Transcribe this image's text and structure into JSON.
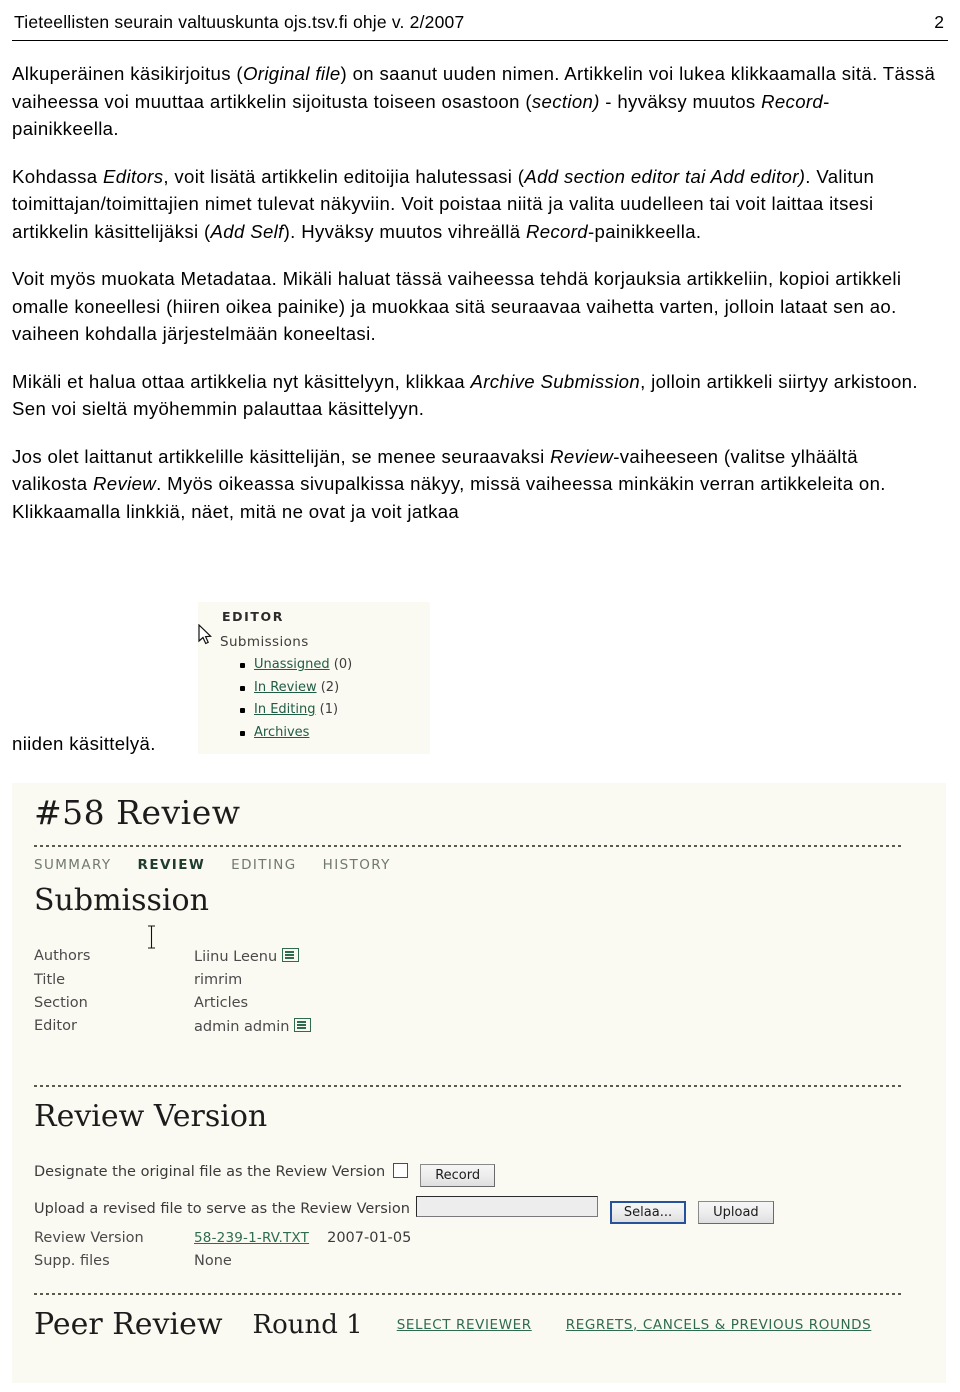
{
  "header": {
    "title": "Tieteellisten seurain valtuuskunta ojs.tsv.fi ohje v. 2/2007",
    "page_number": "2"
  },
  "body": {
    "paragraphs": [
      "Alkuperäinen käsikirjoitus (<em>Original file</em>) on saanut uuden nimen. Artikkelin voi lukea klikkaamalla sitä. Tässä vaiheessa voi muuttaa artikkelin sijoitusta toiseen osastoon (<em>section)</em> - hyväksy muutos <em>Record</em>-painikkeella.",
      "Kohdassa <em>Editors</em>, voit lisätä artikkelin editoijia halutessasi (<em>Add section editor tai Add editor)</em>. Valitun toimittajan/toimittajien nimet tulevat näkyviin. Voit poistaa niitä ja valita uudelleen tai  voit laittaa itsesi artikkelin käsittelijäksi (<em>Add Self</em>). Hyväksy muutos vihreällä <em>Record</em>-painikkeella.",
      "Voit myös muokata Metadataa. Mikäli haluat tässä vaiheessa tehdä korjauksia artikkeliin, kopioi artikkeli omalle koneellesi (hiiren oikea painike) ja muokkaa sitä seuraavaa vaihetta varten, jolloin lataat sen ao. vaiheen kohdalla järjestelmään koneeltasi.",
      "Mikäli et halua ottaa artikkelia nyt käsittelyyn, klikkaa <em>Archive Submission</em>, jolloin artikkeli siirtyy arkistoon. Sen voi sieltä myöhemmin palauttaa käsittelyyn.",
      "Jos olet laittanut artikkelille käsittelijän, se menee seuraavaksi <em>Review</em>-vaiheeseen (valitse ylhäältä valikosta <em>Review</em>. Myös oikeassa sivupalkissa näkyy, missä vaiheessa minkäkin verran artikkeleita on. Klikkaamalla linkkiä, näet, mitä ne ovat ja voit jatkaa"
    ],
    "tail_text": "niiden käsittelyä."
  },
  "editor_panel": {
    "title": "EDITOR",
    "subtitle": "Submissions",
    "items": [
      {
        "label": "Unassigned",
        "count": "(0)"
      },
      {
        "label": "In Review",
        "count": "(2)"
      },
      {
        "label": "In Editing",
        "count": "(1)"
      },
      {
        "label": "Archives",
        "count": ""
      }
    ]
  },
  "ojs_panel": {
    "submission_id": "#58 Review",
    "tabs": [
      {
        "label": "SUMMARY",
        "active": false
      },
      {
        "label": "REVIEW",
        "active": true
      },
      {
        "label": "EDITING",
        "active": false
      },
      {
        "label": "HISTORY",
        "active": false
      }
    ],
    "submission": {
      "heading": "Submission",
      "rows": [
        {
          "key": "Authors",
          "value": "Liinu Leenu",
          "mail_icon": true
        },
        {
          "key": "Title",
          "value": "rimrim",
          "mail_icon": false
        },
        {
          "key": "Section",
          "value": "Articles",
          "mail_icon": false
        },
        {
          "key": "Editor",
          "value": "admin admin",
          "mail_icon": true
        }
      ]
    },
    "review_version": {
      "heading": "Review Version",
      "designate_label": "Designate the original file as the Review Version",
      "record_button": "Record",
      "upload_label": "Upload a revised file to serve as the Review Version",
      "file_input_value": "",
      "browse_button": "Selaa...",
      "upload_button": "Upload",
      "version_key": "Review Version",
      "version_file": "58-239-1-RV.TXT",
      "version_date": "2007-01-05",
      "supp_key": "Supp. files",
      "supp_value": "None"
    },
    "peer_review": {
      "title": "Peer Review",
      "round": "Round 1",
      "links": [
        "SELECT REVIEWER",
        "REGRETS, CANCELS & PREVIOUS ROUNDS"
      ]
    }
  },
  "colors": {
    "screenshot_bg": "#fbfaf2",
    "link_green": "#2e6b4f",
    "tab_active": "#1f3d2e",
    "page_bg": "#ffffff"
  }
}
